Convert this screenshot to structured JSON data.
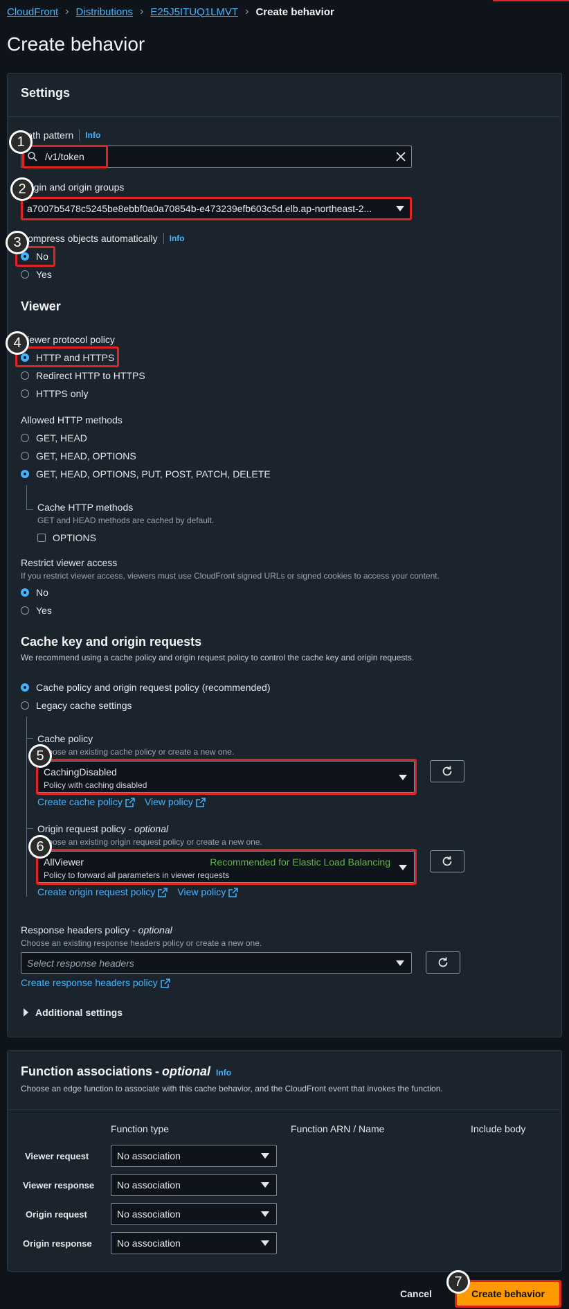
{
  "breadcrumb": {
    "items": [
      "CloudFront",
      "Distributions",
      "E25J5ITUQ1LMVT"
    ],
    "current": "Create behavior"
  },
  "page_title": "Create behavior",
  "settings": {
    "heading": "Settings",
    "path_pattern": {
      "label": "Path pattern",
      "info": "Info",
      "value": "/v1/token"
    },
    "origin": {
      "label": "Origin and origin groups",
      "value": "a7007b5478c5245be8ebbf0a0a70854b-e473239efb603c5d.elb.ap-northeast-2..."
    },
    "compress": {
      "label": "Compress objects automatically",
      "info": "Info",
      "options": [
        "No",
        "Yes"
      ],
      "selected": "No"
    }
  },
  "viewer": {
    "heading": "Viewer",
    "protocol": {
      "label": "Viewer protocol policy",
      "options": [
        "HTTP and HTTPS",
        "Redirect HTTP to HTTPS",
        "HTTPS only"
      ],
      "selected": "HTTP and HTTPS"
    },
    "methods": {
      "label": "Allowed HTTP methods",
      "options": [
        "GET, HEAD",
        "GET, HEAD, OPTIONS",
        "GET, HEAD, OPTIONS, PUT, POST, PATCH, DELETE"
      ],
      "selected": "GET, HEAD, OPTIONS, PUT, POST, PATCH, DELETE"
    },
    "cache_methods": {
      "label": "Cache HTTP methods",
      "desc": "GET and HEAD methods are cached by default.",
      "option": "OPTIONS",
      "checked": false
    },
    "restrict": {
      "label": "Restrict viewer access",
      "desc": "If you restrict viewer access, viewers must use CloudFront signed URLs or signed cookies to access your content.",
      "options": [
        "No",
        "Yes"
      ],
      "selected": "No"
    }
  },
  "cache": {
    "heading": "Cache key and origin requests",
    "desc": "We recommend using a cache policy and origin request policy to control the cache key and origin requests.",
    "options": [
      "Cache policy and origin request policy (recommended)",
      "Legacy cache settings"
    ],
    "selected": "Cache policy and origin request policy (recommended)",
    "cache_policy": {
      "label": "Cache policy",
      "desc": "Choose an existing cache policy or create a new one.",
      "value": "CachingDisabled",
      "sub": "Policy with caching disabled",
      "create_link": "Create cache policy",
      "view_link": "View policy"
    },
    "origin_request_policy": {
      "label": "Origin request policy",
      "optional": "optional",
      "desc": "Choose an existing origin request policy or create a new one.",
      "value": "AllViewer",
      "recommended": "Recommended for Elastic Load Balancing",
      "sub": "Policy to forward all parameters in viewer requests",
      "create_link": "Create origin request policy",
      "view_link": "View policy"
    },
    "response_headers_policy": {
      "label": "Response headers policy",
      "optional": "optional",
      "desc": "Choose an existing response headers policy or create a new one.",
      "placeholder": "Select response headers",
      "create_link": "Create response headers policy"
    },
    "additional": "Additional settings"
  },
  "functions": {
    "heading": "Function associations",
    "optional": "optional",
    "info": "Info",
    "desc": "Choose an edge function to associate with this cache behavior, and the CloudFront event that invokes the function.",
    "columns": [
      "Function type",
      "Function ARN / Name",
      "Include body"
    ],
    "rows": [
      {
        "label": "Viewer request",
        "value": "No association"
      },
      {
        "label": "Viewer response",
        "value": "No association"
      },
      {
        "label": "Origin request",
        "value": "No association"
      },
      {
        "label": "Origin response",
        "value": "No association"
      }
    ]
  },
  "footer": {
    "cancel": "Cancel",
    "submit": "Create behavior"
  },
  "annotations": [
    "1",
    "2",
    "3",
    "4",
    "5",
    "6",
    "7"
  ],
  "colors": {
    "accent": "#42b4ff",
    "highlight": "#e02424",
    "primary_button": "#ff9900",
    "recommended": "#5fb34a"
  }
}
